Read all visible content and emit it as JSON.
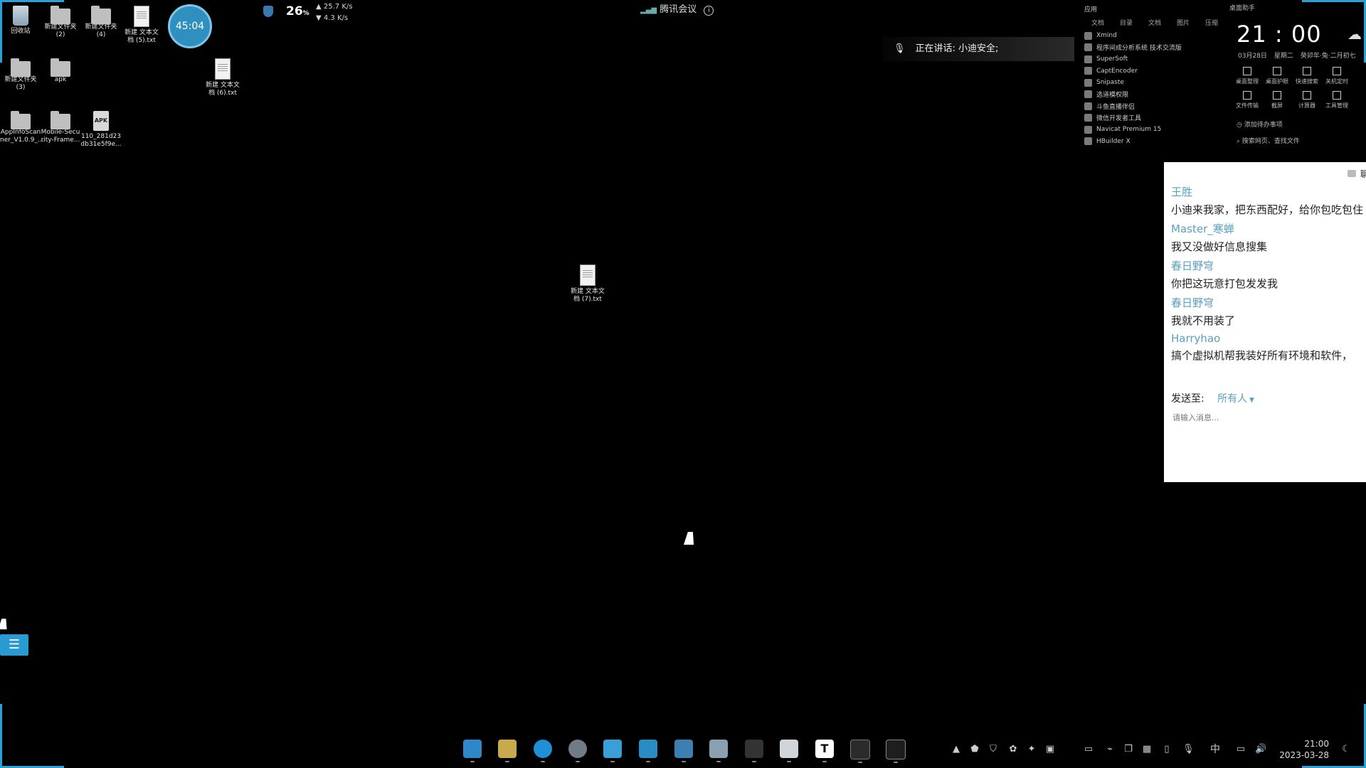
{
  "desktop": {
    "icons": [
      {
        "label": "回收站"
      },
      {
        "label": "新建文件夹\n(2)"
      },
      {
        "label": "新建文件夹\n(4)"
      },
      {
        "label": "新建 文本文\n档 (5).txt"
      },
      {
        "label": "新建文件夹\n(3)"
      },
      {
        "label": "apk"
      },
      {
        "label": "新建 文本文\n档 (6).txt"
      },
      {
        "label": "AppInfoScan\nner_V1.0.9_..."
      },
      {
        "label": "Mobile-Secu\nrity-Frame..."
      },
      {
        "label": "110_281d23\ndb31e5f9e..."
      },
      {
        "label": "新建 文本文\n档 (7).txt"
      }
    ],
    "apk_badge": "APK"
  },
  "timer": "45:04",
  "network": {
    "cpu": "26",
    "cpu_unit": "%",
    "up": "25.7 K/s",
    "down": "4.3 K/s"
  },
  "meeting": {
    "title": "腾讯会议",
    "speaking": "正在讲话: 小迪安全;"
  },
  "apps_panel": {
    "header": "应用",
    "tabs": [
      "文档",
      "目录",
      "文档",
      "图片",
      "压缩"
    ],
    "items": [
      "Xmind",
      "程序间成分析系统 技术交流版",
      "SuperSoft",
      "CaptEncoder",
      "Snipaste",
      "选道模权限",
      "斗鱼直播伴侣",
      "微信开发者工具",
      "Navicat Premium 15",
      "HBuilder X"
    ]
  },
  "clock_widget": {
    "header": "桌面助手",
    "time": "21 : 00",
    "date": "03月28日",
    "weekday": "星期二",
    "lunar": "癸卯年·兔·二月初七",
    "tools": [
      "桌面整理",
      "桌面护眼",
      "快速搜索",
      "关机定时",
      "文件传输",
      "截屏",
      "计算器",
      "工具管理"
    ],
    "todo": "添加待办事项",
    "search": "搜索网页、查找文件"
  },
  "chat": {
    "title": "聊天",
    "messages": [
      {
        "name": "王胜",
        "text": "小迪来我家，把东西配好，给你包吃包住"
      },
      {
        "name": "Master_寒蝉",
        "text": "我又没做好信息搜集"
      },
      {
        "name": "春日野穹",
        "text": "你把这玩意打包发发我"
      },
      {
        "name": "春日野穹",
        "text": "我就不用装了"
      },
      {
        "name": "Harryhao",
        "text": "搞个虚拟机帮我装好所有环境和软件，"
      }
    ],
    "send_to_label": "发送至:",
    "send_to_value": "所有人",
    "input_placeholder": "请输入消息..."
  },
  "taskbar": {
    "time": "21:00",
    "date": "2023-03-28",
    "ime": "中"
  }
}
